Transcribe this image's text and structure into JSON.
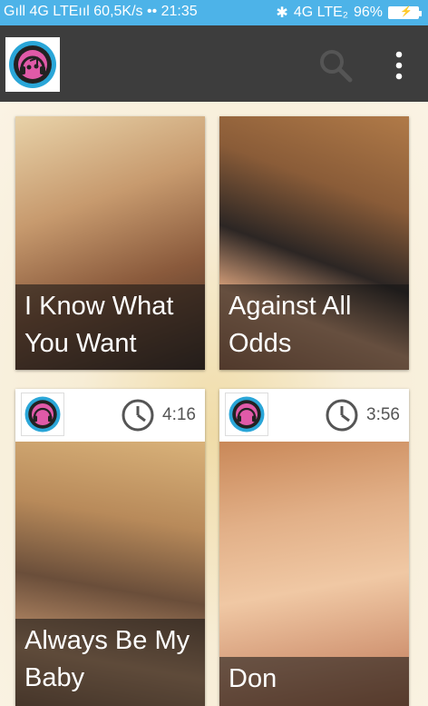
{
  "status_bar": {
    "left": "Gıll 4G LTEııl 60,5K/s •• 21:35",
    "network": "4G LTE₂",
    "battery": "96%"
  },
  "app_bar": {
    "logo_icon": "headphones-app-logo",
    "search_icon": "search-icon",
    "menu_icon": "more-vert-icon"
  },
  "videos": [
    {
      "title": "I Know What You Want",
      "duration": ""
    },
    {
      "title": "Against All Odds",
      "duration": ""
    },
    {
      "title": "Always Be My Baby",
      "duration": "4:16"
    },
    {
      "title": "Don",
      "duration": "3:56"
    }
  ],
  "colors": {
    "status_bar": "#4db3e8",
    "app_bar": "#3d3d3d",
    "logo_ring": "#2aa6d8",
    "logo_center": "#e05aa8"
  }
}
